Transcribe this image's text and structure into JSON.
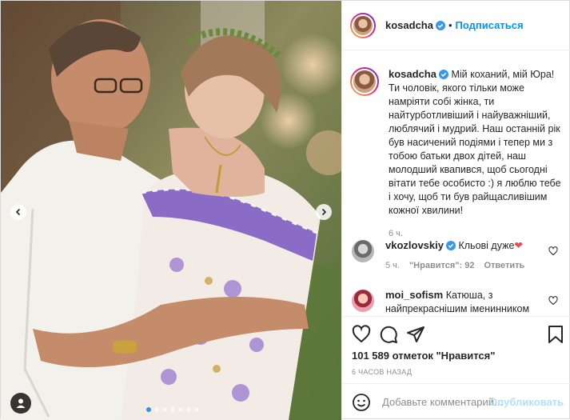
{
  "post": {
    "author": "kosadcha",
    "follow_label": "Подписаться",
    "separator": "•",
    "caption": "Мій коханий, мій Юра! Ти чоловік, якого тільки може намріяти собі жінка, ти найтурботливіший і найуважніший, люблячий і мудрий. Наш останній рік був насичений подіями і тепер ми з тобою батьки двох дітей, наш молодший квапився, щоб сьогодні вітати тебе особисто :) я люблю тебе і хочу, щоб ти був райщасливішим кожної хвилини!",
    "caption_time": "6 ч.",
    "likes": "101 589 отметок \"Нравится\"",
    "posted_ago": "6 ЧАСОВ НАЗАД",
    "comment_placeholder": "Добавьте комментарий...",
    "publish_label": "Опубликовать"
  },
  "comments": [
    {
      "user": "vkozlovskiy",
      "text": "Кльові дуже",
      "emoji": "❤",
      "time": "5 ч.",
      "likes": "\"Нравится\": 92",
      "reply": "Ответить"
    },
    {
      "user": "moi_sofism",
      "text": "Катюша, з найпрекраснішим іменинником"
    }
  ],
  "carousel": {
    "total": 7,
    "active_index": 0
  },
  "colors": {
    "accent": "#0095f6",
    "verified": "#3897f0",
    "heart": "#ed4956",
    "muted": "#8e8e8e"
  },
  "icons": [
    "chevron-left-icon",
    "chevron-right-icon",
    "user-tag-icon",
    "verified-badge-icon",
    "heart-icon",
    "comment-icon",
    "share-icon",
    "bookmark-icon",
    "emoji-icon"
  ]
}
